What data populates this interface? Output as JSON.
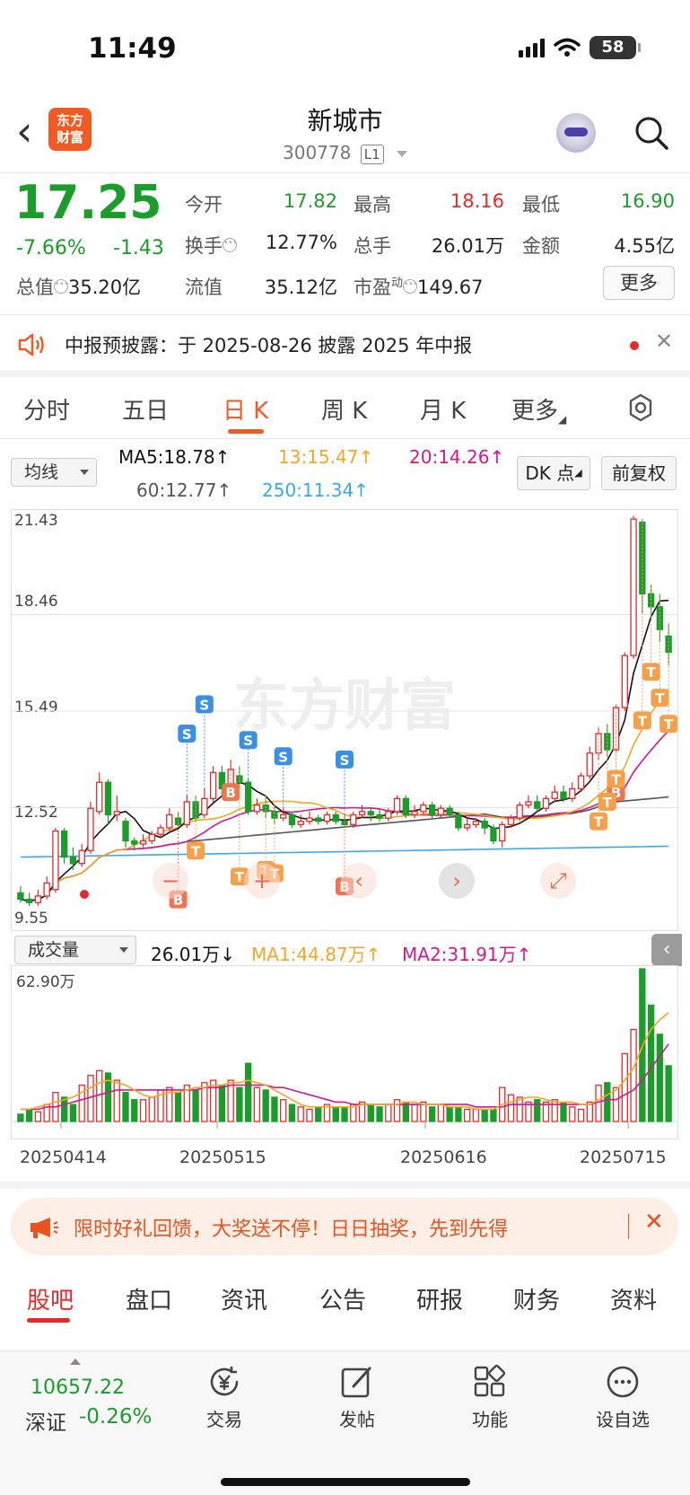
{
  "status_bar": {
    "time": "11:49",
    "battery": "58"
  },
  "header": {
    "title": "新城市",
    "code": "300778",
    "level": "L1",
    "logo_text": "东方财富"
  },
  "quote": {
    "price": "17.25",
    "change_pct": "-7.66%",
    "change": "-1.43",
    "fields": [
      {
        "label": "今开",
        "value": "17.82"
      },
      {
        "label": "最高",
        "value": "18.16"
      },
      {
        "label": "最低",
        "value": "16.90"
      },
      {
        "label": "换手",
        "value": "12.77%"
      },
      {
        "label": "总手",
        "value": "26.01万"
      },
      {
        "label": "金额",
        "value": "4.55亿"
      },
      {
        "label": "流值",
        "value": "35.12亿"
      }
    ],
    "market_cap_label": "总值",
    "market_cap": "35.20亿",
    "pe_label": "市盈",
    "pe_sup": "动",
    "pe_value": "149.67",
    "more_label": "更多"
  },
  "notice": {
    "text": "中报预披露：于 2025-08-26 披露 2025 年中报"
  },
  "chart_tabs": [
    "分时",
    "五日",
    "日 K",
    "周 K",
    "月 K",
    "更多"
  ],
  "indicator": {
    "select": "均线",
    "ma5": "MA5:18.78↑",
    "ma13": "13:15.47↑",
    "ma20": "20:14.26↑",
    "ma60": "60:12.77↑",
    "ma250": "250:11.34↑",
    "dk_button": "DK 点",
    "adjust_button": "前复权"
  },
  "volume_indicator": {
    "select": "成交量",
    "volume": "26.01万↓",
    "ma1": "MA1:44.87万↑",
    "ma2": "MA2:31.91万↑"
  },
  "colors": {
    "up": "#e8292a",
    "down": "#1a9d2a",
    "accent": "#f15a22",
    "ma5": "#111111",
    "ma13": "#f5a623",
    "ma20": "#d6168c",
    "ma60": "#555555",
    "ma250": "#3aa8f0"
  },
  "chart_data": {
    "type": "candlestick",
    "y_ticks": [
      "21.43",
      "18.46",
      "15.49",
      "12.52",
      "9.55"
    ],
    "ylim": [
      9.55,
      21.43
    ],
    "x_ticks": [
      "20250414",
      "20250515",
      "20250616",
      "20250715"
    ],
    "volume_max_label": "62.90万",
    "candles": [
      [
        9.9,
        9.7,
        10.1,
        9.6
      ],
      [
        9.7,
        9.6,
        9.9,
        9.5
      ],
      [
        9.6,
        9.8,
        10.0,
        9.5
      ],
      [
        9.8,
        10.2,
        10.4,
        9.7
      ],
      [
        10.0,
        11.8,
        11.9,
        9.9
      ],
      [
        11.8,
        11.0,
        11.9,
        10.8
      ],
      [
        11.0,
        10.8,
        11.3,
        10.6
      ],
      [
        10.8,
        11.2,
        11.4,
        10.7
      ],
      [
        11.2,
        12.5,
        12.7,
        11.1
      ],
      [
        12.4,
        13.3,
        13.6,
        12.3
      ],
      [
        13.3,
        12.3,
        13.4,
        12.0
      ],
      [
        12.3,
        12.4,
        12.9,
        12.1
      ],
      [
        12.1,
        11.5,
        12.2,
        11.3
      ],
      [
        11.5,
        11.4,
        11.6,
        11.2
      ],
      [
        11.4,
        11.5,
        11.7,
        11.3
      ],
      [
        11.5,
        11.7,
        11.8,
        11.4
      ],
      [
        11.7,
        11.9,
        12.0,
        11.6
      ],
      [
        11.9,
        12.3,
        12.5,
        11.8
      ],
      [
        12.2,
        12.0,
        12.4,
        11.9
      ],
      [
        12.0,
        12.7,
        12.9,
        11.9
      ],
      [
        12.7,
        12.2,
        12.9,
        12.1
      ],
      [
        12.3,
        12.8,
        13.1,
        12.2
      ],
      [
        12.8,
        13.6,
        13.8,
        12.7
      ],
      [
        13.6,
        13.1,
        13.8,
        12.9
      ],
      [
        13.2,
        13.7,
        14.0,
        13.0
      ],
      [
        13.5,
        13.3,
        13.8,
        13.1
      ],
      [
        13.3,
        12.4,
        13.4,
        12.3
      ],
      [
        12.4,
        12.6,
        12.8,
        12.3
      ],
      [
        12.6,
        12.4,
        12.9,
        12.2
      ],
      [
        12.4,
        12.2,
        12.6,
        12.0
      ],
      [
        12.2,
        12.3,
        12.5,
        12.1
      ],
      [
        12.3,
        12.0,
        12.4,
        11.9
      ],
      [
        12.0,
        12.1,
        12.3,
        11.9
      ],
      [
        12.1,
        12.2,
        12.4,
        12.0
      ],
      [
        12.2,
        12.1,
        12.3,
        12.0
      ],
      [
        12.1,
        12.3,
        12.4,
        12.0
      ],
      [
        12.3,
        12.1,
        12.4,
        12.0
      ],
      [
        12.1,
        12.0,
        12.3,
        11.9
      ],
      [
        12.0,
        12.3,
        12.4,
        11.9
      ],
      [
        12.3,
        12.4,
        12.6,
        12.2
      ],
      [
        12.4,
        12.3,
        12.5,
        12.1
      ],
      [
        12.3,
        12.2,
        12.5,
        12.1
      ],
      [
        12.2,
        12.4,
        12.5,
        12.1
      ],
      [
        12.4,
        12.8,
        12.9,
        12.3
      ],
      [
        12.8,
        12.3,
        12.9,
        12.2
      ],
      [
        12.3,
        12.4,
        12.6,
        12.2
      ],
      [
        12.4,
        12.6,
        12.7,
        12.3
      ],
      [
        12.6,
        12.3,
        12.7,
        12.2
      ],
      [
        12.3,
        12.5,
        12.6,
        12.2
      ],
      [
        12.5,
        12.3,
        12.6,
        12.2
      ],
      [
        12.3,
        11.9,
        12.4,
        11.8
      ],
      [
        11.9,
        12.0,
        12.2,
        11.8
      ],
      [
        12.0,
        12.1,
        12.2,
        11.9
      ],
      [
        12.1,
        11.9,
        12.2,
        11.7
      ],
      [
        11.9,
        11.5,
        12.0,
        11.4
      ],
      [
        11.5,
        12.0,
        12.1,
        11.3
      ],
      [
        12.0,
        12.2,
        12.3,
        11.9
      ],
      [
        12.2,
        12.6,
        12.7,
        12.1
      ],
      [
        12.6,
        12.7,
        12.9,
        12.5
      ],
      [
        12.7,
        12.5,
        12.9,
        12.4
      ],
      [
        12.5,
        12.8,
        12.9,
        12.4
      ],
      [
        12.8,
        13.0,
        13.2,
        12.7
      ],
      [
        13.0,
        12.8,
        13.2,
        12.7
      ],
      [
        12.8,
        13.1,
        13.3,
        12.7
      ],
      [
        13.1,
        13.5,
        13.6,
        13.0
      ],
      [
        13.5,
        14.2,
        14.4,
        13.4
      ],
      [
        14.2,
        14.8,
        15.0,
        14.0
      ],
      [
        14.8,
        14.3,
        15.1,
        14.1
      ],
      [
        14.3,
        15.6,
        15.7,
        14.2
      ],
      [
        15.6,
        17.2,
        17.3,
        15.5
      ],
      [
        17.2,
        21.4,
        21.5,
        17.1
      ],
      [
        21.3,
        19.1,
        21.4,
        18.5
      ],
      [
        19.1,
        18.7,
        19.4,
        18.3
      ],
      [
        18.7,
        18.0,
        19.1,
        17.6
      ],
      [
        17.8,
        17.3,
        18.2,
        16.9
      ]
    ],
    "volumes": [
      3,
      5,
      4,
      7,
      12,
      10,
      7,
      15,
      19,
      21,
      20,
      17,
      12,
      9,
      9,
      10,
      13,
      14,
      12,
      15,
      13,
      16,
      17,
      15,
      17,
      14,
      24,
      14,
      13,
      10,
      9,
      7,
      6,
      5,
      6,
      7,
      6,
      6,
      7,
      8,
      7,
      6,
      7,
      9,
      8,
      7,
      8,
      6,
      7,
      6,
      6,
      5,
      5,
      5,
      5,
      14,
      11,
      10,
      8,
      9,
      8,
      9,
      8,
      6,
      5,
      8,
      15,
      16,
      14,
      28,
      38,
      63,
      48,
      36,
      23
    ],
    "ma1": [
      5,
      5,
      6,
      7,
      8,
      9,
      10,
      12,
      14,
      16,
      17,
      16,
      15,
      13,
      11,
      10,
      11,
      12,
      12,
      13,
      14,
      14,
      15,
      15,
      16,
      16,
      17,
      16,
      15,
      13,
      11,
      9,
      7,
      6,
      6,
      6,
      6,
      6,
      6,
      7,
      7,
      7,
      7,
      7,
      8,
      8,
      7,
      7,
      7,
      6,
      6,
      6,
      5,
      5,
      5,
      7,
      8,
      9,
      10,
      10,
      9,
      8,
      8,
      8,
      7,
      7,
      9,
      11,
      13,
      17,
      22,
      31,
      38,
      42,
      45
    ],
    "ma2": [
      5,
      5,
      5,
      6,
      6,
      7,
      8,
      9,
      10,
      11,
      12,
      13,
      13,
      13,
      13,
      13,
      13,
      13,
      13,
      13,
      13,
      14,
      14,
      14,
      15,
      15,
      15,
      15,
      15,
      14,
      14,
      13,
      12,
      11,
      10,
      9,
      8,
      8,
      7,
      7,
      7,
      7,
      7,
      7,
      7,
      7,
      7,
      7,
      7,
      7,
      7,
      7,
      6,
      6,
      6,
      6,
      7,
      7,
      7,
      7,
      7,
      7,
      7,
      7,
      7,
      7,
      8,
      9,
      9,
      11,
      13,
      17,
      22,
      27,
      32
    ]
  },
  "promo": {
    "text": "限时好礼回馈，大奖送不停！日日抽奖，先到先得"
  },
  "bottom_tabs": [
    "股吧",
    "盘口",
    "资讯",
    "公告",
    "研报",
    "财务",
    "资料"
  ],
  "bottom_nav": {
    "index_value": "10657.22",
    "index_name": "深证",
    "index_change": "-0.26%",
    "items": [
      {
        "label": "交易",
        "icon": "yuan-exchange-icon"
      },
      {
        "label": "发帖",
        "icon": "edit-post-icon"
      },
      {
        "label": "功能",
        "icon": "grid-apps-icon"
      },
      {
        "label": "设自选",
        "icon": "chat-dots-icon"
      }
    ]
  },
  "watermark": "东方财富"
}
